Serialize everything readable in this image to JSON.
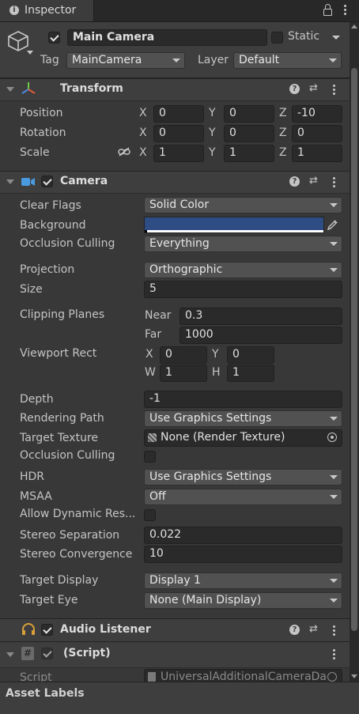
{
  "window": {
    "tab_title": "Inspector"
  },
  "header": {
    "object_name": "Main Camera",
    "static_label": "Static",
    "tag_label": "Tag",
    "tag_value": "MainCamera",
    "layer_label": "Layer",
    "layer_value": "Default"
  },
  "transform": {
    "title": "Transform",
    "position": {
      "label": "Position",
      "x": "0",
      "y": "0",
      "z": "-10"
    },
    "rotation": {
      "label": "Rotation",
      "x": "0",
      "y": "0",
      "z": "0"
    },
    "scale": {
      "label": "Scale",
      "x": "1",
      "y": "1",
      "z": "1"
    },
    "axis": {
      "x": "X",
      "y": "Y",
      "z": "Z"
    }
  },
  "camera": {
    "title": "Camera",
    "clear_flags": {
      "label": "Clear Flags",
      "value": "Solid Color"
    },
    "background": {
      "label": "Background",
      "color": "#2f4d85"
    },
    "occlusion_culling_mask": {
      "label": "Occlusion Culling",
      "value": "Everything"
    },
    "projection": {
      "label": "Projection",
      "value": "Orthographic"
    },
    "size": {
      "label": "Size",
      "value": "5"
    },
    "clipping": {
      "label": "Clipping Planes",
      "near_label": "Near",
      "near": "0.3",
      "far_label": "Far",
      "far": "1000"
    },
    "viewport": {
      "label": "Viewport Rect",
      "x_label": "X",
      "x": "0",
      "y_label": "Y",
      "y": "0",
      "w_label": "W",
      "w": "1",
      "h_label": "H",
      "h": "1"
    },
    "depth": {
      "label": "Depth",
      "value": "-1"
    },
    "rendering_path": {
      "label": "Rendering Path",
      "value": "Use Graphics Settings"
    },
    "target_texture": {
      "label": "Target Texture",
      "value": "None (Render Texture)"
    },
    "occlusion_culling": {
      "label": "Occlusion Culling",
      "checked": false
    },
    "hdr": {
      "label": "HDR",
      "value": "Use Graphics Settings"
    },
    "msaa": {
      "label": "MSAA",
      "value": "Off"
    },
    "dynamic_res": {
      "label": "Allow Dynamic Res...",
      "checked": false
    },
    "stereo_sep": {
      "label": "Stereo Separation",
      "value": "0.022"
    },
    "stereo_conv": {
      "label": "Stereo Convergence",
      "value": "10"
    },
    "target_display": {
      "label": "Target Display",
      "value": "Display 1"
    },
    "target_eye": {
      "label": "Target Eye",
      "value": "None (Main Display)"
    }
  },
  "audio_listener": {
    "title": "Audio Listener"
  },
  "script": {
    "title": "(Script)",
    "field_label": "Script",
    "value": "UniversalAdditionalCameraDa"
  },
  "footer": {
    "asset_labels": "Asset Labels"
  },
  "colors": {
    "accent": "#2f4d85",
    "panel": "#383838",
    "header": "#3e3e3e"
  }
}
